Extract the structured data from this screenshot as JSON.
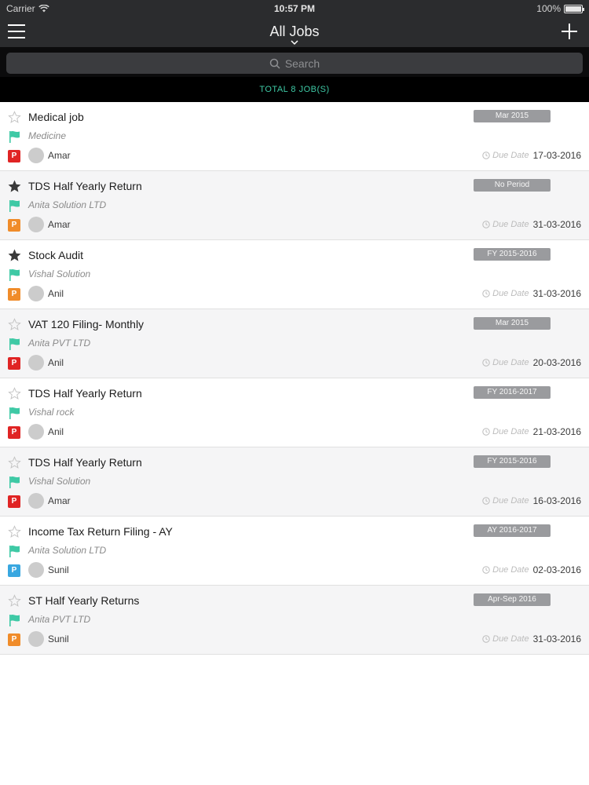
{
  "status": {
    "carrier": "Carrier",
    "time": "10:57 PM",
    "battery": "100%"
  },
  "nav": {
    "title": "All Jobs"
  },
  "search": {
    "placeholder": "Search"
  },
  "total": "TOTAL 8 JOB(S)",
  "colors": {
    "accent": "#3ec9a5",
    "flag": "#3ec9a5",
    "prio_red": "#e02424",
    "prio_orange": "#f08c2a",
    "prio_blue": "#39a7e0"
  },
  "due_label": "Due Date",
  "jobs": [
    {
      "title": "Medical job",
      "client": "Medicine",
      "owner": "Amar",
      "period": "Mar 2015",
      "due": "17-03-2016",
      "starred": false,
      "priority": "P",
      "priority_color": "#e02424"
    },
    {
      "title": "TDS Half Yearly Return",
      "client": "Anita Solution LTD",
      "owner": "Amar",
      "period": "No Period",
      "due": "31-03-2016",
      "starred": true,
      "priority": "P",
      "priority_color": "#f08c2a"
    },
    {
      "title": "Stock Audit",
      "client": "Vishal Solution",
      "owner": "Anil",
      "period": "FY 2015-2016",
      "due": "31-03-2016",
      "starred": true,
      "priority": "P",
      "priority_color": "#f08c2a"
    },
    {
      "title": "VAT 120 Filing- Monthly",
      "client": "Anita PVT LTD",
      "owner": "Anil",
      "period": "Mar 2015",
      "due": "20-03-2016",
      "starred": false,
      "priority": "P",
      "priority_color": "#e02424"
    },
    {
      "title": "TDS Half Yearly Return",
      "client": "Vishal rock",
      "owner": "Anil",
      "period": "FY 2016-2017",
      "due": "21-03-2016",
      "starred": false,
      "priority": "P",
      "priority_color": "#e02424"
    },
    {
      "title": "TDS Half Yearly Return",
      "client": "Vishal Solution",
      "owner": "Amar",
      "period": "FY 2015-2016",
      "due": "16-03-2016",
      "starred": false,
      "priority": "P",
      "priority_color": "#e02424"
    },
    {
      "title": "Income Tax Return Filing - AY",
      "client": "Anita Solution LTD",
      "owner": "Sunil",
      "period": "AY 2016-2017",
      "due": "02-03-2016",
      "starred": false,
      "priority": "P",
      "priority_color": "#39a7e0"
    },
    {
      "title": "ST Half Yearly Returns",
      "client": "Anita PVT LTD",
      "owner": "Sunil",
      "period": "Apr-Sep 2016",
      "due": "31-03-2016",
      "starred": false,
      "priority": "P",
      "priority_color": "#f08c2a"
    }
  ]
}
